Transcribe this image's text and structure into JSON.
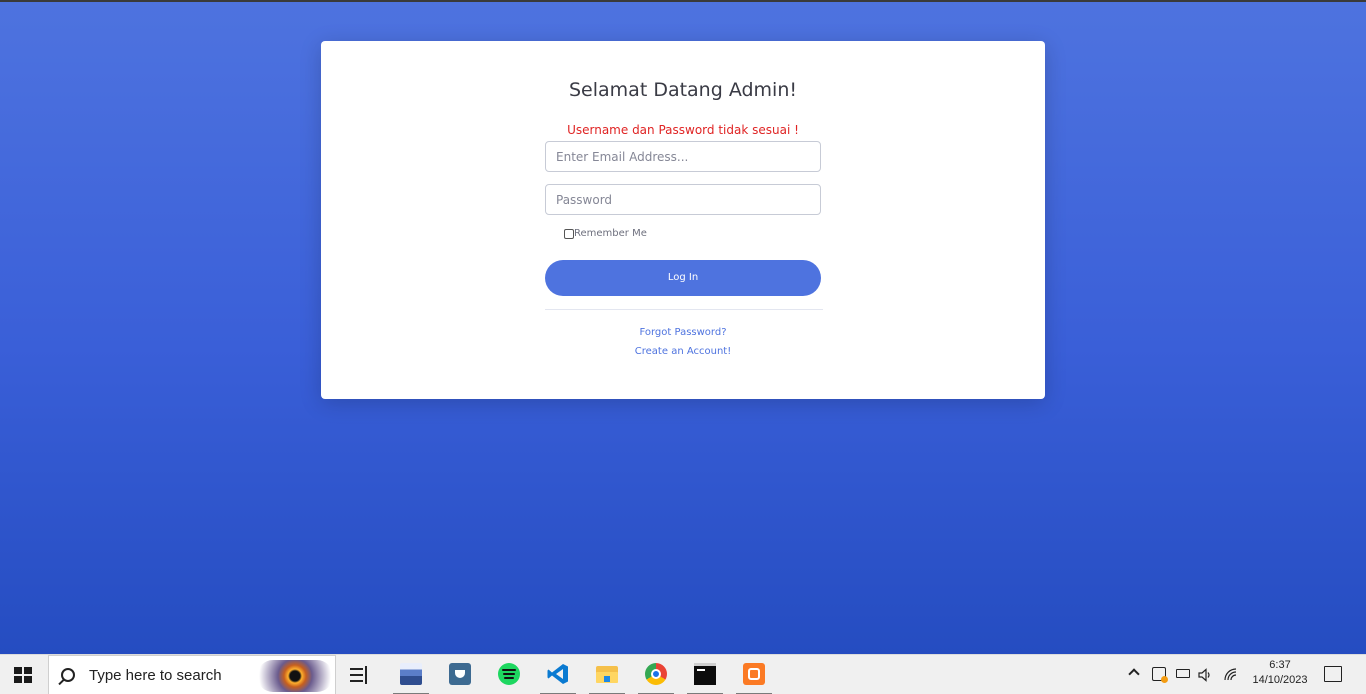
{
  "login": {
    "title": "Selamat Datang Admin!",
    "error": "Username dan Password tidak sesuai !",
    "email_placeholder": "Enter Email Address...",
    "password_placeholder": "Password",
    "remember_label": "Remember Me",
    "login_label": "Log In",
    "forgot_label": "Forgot Password?",
    "create_label": "Create an Account!"
  },
  "taskbar": {
    "search_placeholder": "Type here to search",
    "apps": [
      "file-manager-icon",
      "app-icon",
      "spotify-icon",
      "vscode-icon",
      "file-explorer-icon",
      "chrome-icon",
      "terminal-icon",
      "xampp-icon"
    ],
    "clock_time": "6:37",
    "clock_date": "14/10/2023"
  },
  "colors": {
    "primary": "#4e73df",
    "background_bottom": "#224abe",
    "error": "#e02424"
  }
}
